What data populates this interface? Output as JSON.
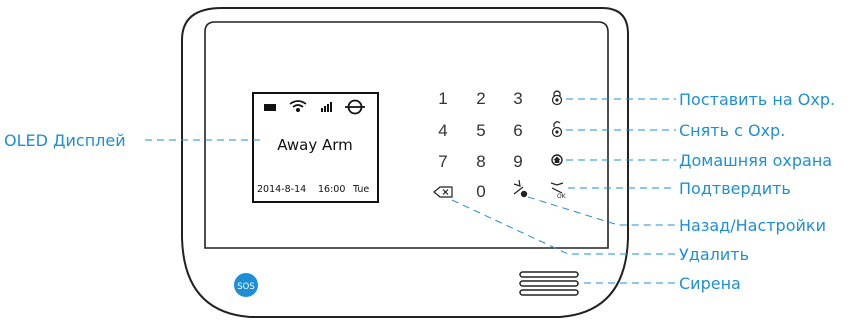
{
  "lcd": {
    "mode_text": "Away Arm",
    "date": "2014-8-14",
    "time": "16:00",
    "weekday": "Tue",
    "status_icons": [
      "battery-icon",
      "wifi-icon",
      "signal-icon",
      "gsm-icon"
    ]
  },
  "keypad": {
    "digits": [
      "1",
      "2",
      "3",
      "4",
      "5",
      "6",
      "7",
      "8",
      "9",
      "0"
    ],
    "function_icons": [
      "arm-lock-icon",
      "disarm-unlock-icon",
      "home-arm-icon",
      "confirm-ok-icon",
      "back-settings-icon",
      "delete-icon"
    ]
  },
  "sos_label": "SOS",
  "callouts": {
    "oled": "OLED Дисплей",
    "arm": "Поставить на Охр.",
    "disarm": "Снять с Охр.",
    "home": "Домашняя охрана",
    "confirm": "Подтвердить",
    "back": "Назад/Настройки",
    "delete": "Удалить",
    "siren": "Сирена"
  },
  "colors": {
    "accent": "#1e8fd6",
    "outline": "#222222"
  }
}
